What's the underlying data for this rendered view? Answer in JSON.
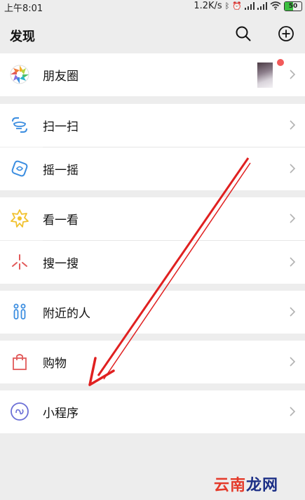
{
  "status_bar": {
    "time": "上午8:01",
    "net_speed": "1.2K/s",
    "battery": "50",
    "battery_level": 0.5
  },
  "header": {
    "title": "发现",
    "search_icon": "search-icon",
    "add_icon": "plus-circle-icon"
  },
  "menu": [
    {
      "label": "朋友圈",
      "icon": "moments-aperture-icon"
    },
    {
      "label": "扫一扫",
      "icon": "scan-icon"
    },
    {
      "label": "摇一摇",
      "icon": "shake-icon"
    },
    {
      "label": "看一看",
      "icon": "top-stories-icon"
    },
    {
      "label": "搜一搜",
      "icon": "search-spark-icon"
    },
    {
      "label": "附近的人",
      "icon": "people-nearby-icon"
    },
    {
      "label": "购物",
      "icon": "shopping-bag-icon"
    },
    {
      "label": "小程序",
      "icon": "mini-program-icon"
    }
  ],
  "watermark": {
    "part1": "云南",
    "part2": "龙网"
  },
  "colors": {
    "background": "#ededed",
    "row": "#ffffff",
    "arrow": "#e02020",
    "badge": "#f25a5a"
  }
}
